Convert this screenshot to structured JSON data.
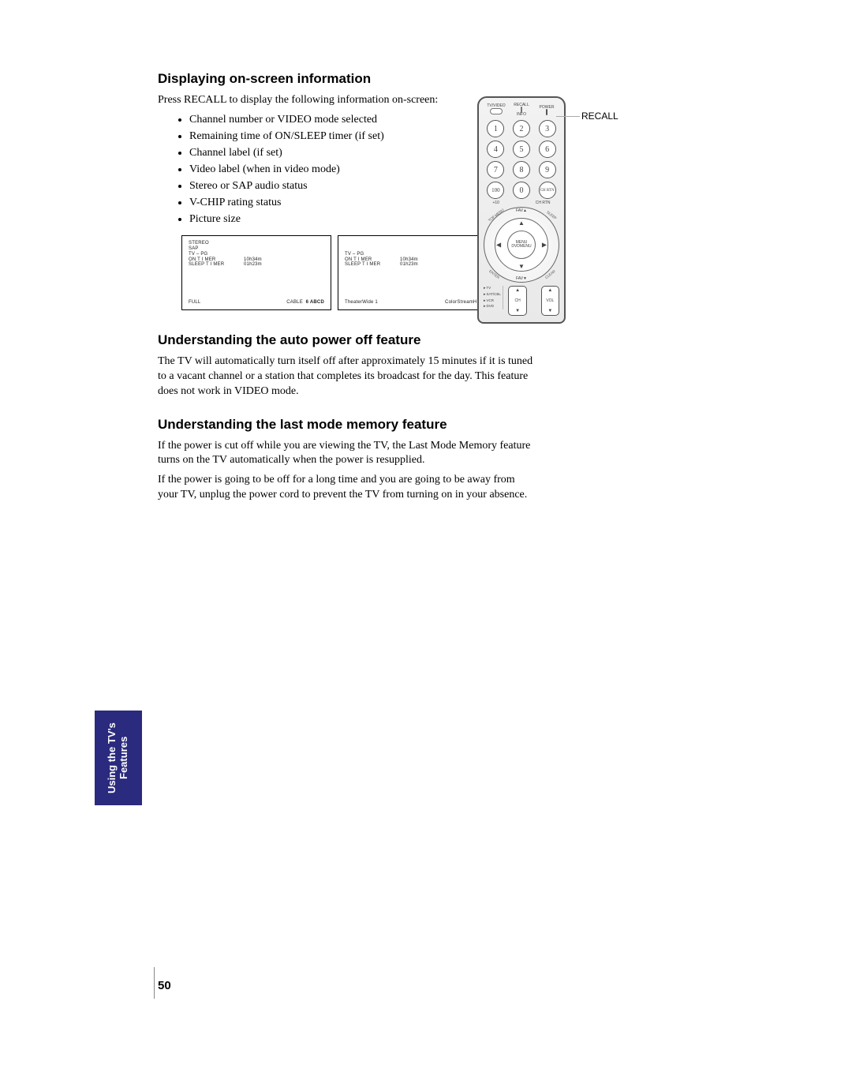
{
  "section1": {
    "heading": "Displaying on-screen information",
    "intro": "Press RECALL to display the following information on-screen:",
    "bullets": [
      "Channel number or VIDEO mode selected",
      "Remaining time of ON/SLEEP timer (if set)",
      "Channel label (if set)",
      "Video label (when in video mode)",
      "Stereo or SAP audio status",
      "V-CHIP rating status",
      "Picture size"
    ]
  },
  "panel1": {
    "l1": "STEREO",
    "l2": "SAP",
    "l3": "TV – PG",
    "l4a": "ON  T I MER",
    "l4b": "10h34m",
    "l5a": "SLEEP  T I MER",
    "l5b": "01h23m",
    "bl": "FULL",
    "brA": "CABLE",
    "brB": "6  ABCD"
  },
  "panel2": {
    "l3": "TV – PG",
    "l4a": "ON  T I MER",
    "l4b": "10h34m",
    "l5a": "SLEEP  T I MER",
    "l5b": "01h23m",
    "bl": "TheaterWide 1",
    "br": "ColorStreamHD"
  },
  "section2": {
    "heading": "Understanding the auto power off feature",
    "p1": "The TV will automatically turn itself off after approximately 15 minutes if it is tuned to a vacant channel or a station that completes its broadcast for the day. This feature does not work in VIDEO mode."
  },
  "section3": {
    "heading": "Understanding the last mode memory feature",
    "p1": "If the power is cut off while you are viewing the TV, the Last Mode Memory feature turns on the TV automatically when the power is resupplied.",
    "p2": "If the power is going to be off for a long time and you are going to be away from your TV, unplug the power cord to prevent the TV from turning on in your absence."
  },
  "remote": {
    "callout": "RECALL",
    "top": {
      "tvvideo": "TV/VIDEO",
      "recall": "RECALL",
      "info": "INFO",
      "power": "POWER"
    },
    "nums": [
      "1",
      "2",
      "3",
      "4",
      "5",
      "6",
      "7",
      "8",
      "9",
      "100",
      "0",
      "CH RTN",
      "+10"
    ],
    "fav_up": "FAV▲",
    "fav_dn": "FAV▼",
    "menu1": "MENU",
    "menu2": "DVDMENU",
    "diag": {
      "tl": "TOP MENU",
      "tr": "SLEEP",
      "bl": "ENTER",
      "br": "CLEAR"
    },
    "dev": [
      "TV",
      "SAT/CBL",
      "VCR",
      "DVD"
    ],
    "ch": "CH",
    "vol": "VOL"
  },
  "sidetab": {
    "l1": "Using the TV's",
    "l2": "Features"
  },
  "page_number": "50"
}
